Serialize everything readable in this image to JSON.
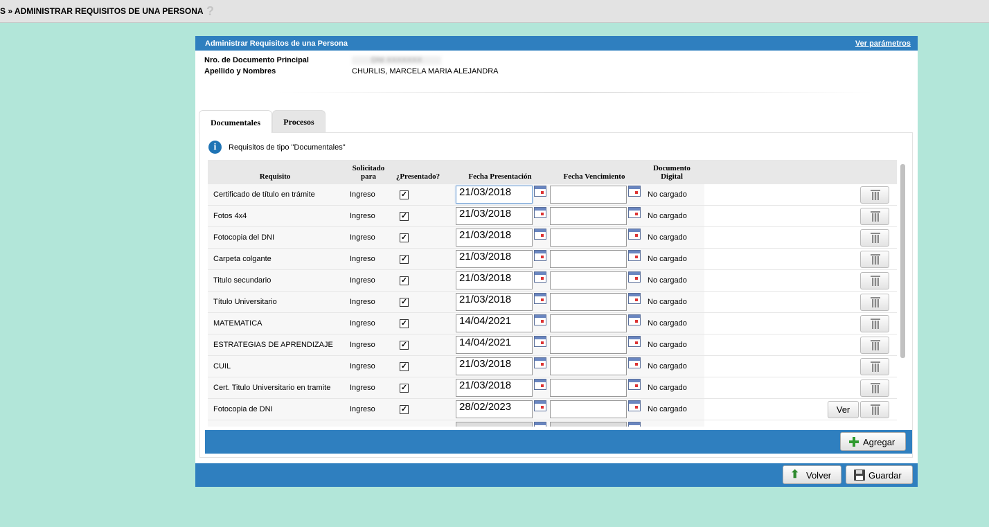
{
  "breadcrumb": {
    "prefix": "S »",
    "title": "ADMINISTRAR REQUISITOS DE UNA PERSONA",
    "help_icon": "question-icon"
  },
  "panel": {
    "title": "Administrar Requisitos de una Persona",
    "params_link": "Ver parámetros"
  },
  "person": {
    "doc_label": "Nro. de Documento Principal",
    "doc_value": "DNI XXXXXXX",
    "name_label": "Apellido y Nombres",
    "name_value": "CHURLIS, MARCELA MARIA ALEJANDRA"
  },
  "tabs": [
    {
      "label": "Documentales",
      "active": true
    },
    {
      "label": "Procesos",
      "active": false
    }
  ],
  "info": {
    "icon": "info-icon",
    "text": "Requisitos de tipo \"Documentales\""
  },
  "table": {
    "headers": {
      "requisito": "Requisito",
      "solicitado": "Solicitado para",
      "presentado": "¿Presentado?",
      "fecha_presentacion": "Fecha Presentación",
      "fecha_vencimiento": "Fecha Vencimiento",
      "documento_digital": "Documento Digital"
    },
    "rows": [
      {
        "requisito": "Certificado de título en trámite",
        "solicitado": "Ingreso",
        "presentado": "✓",
        "fecha": "21/03/2018",
        "vencimiento": "",
        "documento": "No cargado",
        "ver": ""
      },
      {
        "requisito": "Fotos 4x4",
        "solicitado": "Ingreso",
        "presentado": "✓",
        "fecha": "21/03/2018",
        "vencimiento": "",
        "documento": "No cargado",
        "ver": ""
      },
      {
        "requisito": "Fotocopia del DNI",
        "solicitado": "Ingreso",
        "presentado": "✓",
        "fecha": "21/03/2018",
        "vencimiento": "",
        "documento": "No cargado",
        "ver": ""
      },
      {
        "requisito": "Carpeta colgante",
        "solicitado": "Ingreso",
        "presentado": "✓",
        "fecha": "21/03/2018",
        "vencimiento": "",
        "documento": "No cargado",
        "ver": ""
      },
      {
        "requisito": "Titulo secundario",
        "solicitado": "Ingreso",
        "presentado": "✓",
        "fecha": "21/03/2018",
        "vencimiento": "",
        "documento": "No cargado",
        "ver": ""
      },
      {
        "requisito": "Título Universitario",
        "solicitado": "Ingreso",
        "presentado": "✓",
        "fecha": "21/03/2018",
        "vencimiento": "",
        "documento": "No cargado",
        "ver": ""
      },
      {
        "requisito": "MATEMATICA",
        "solicitado": "Ingreso",
        "presentado": "✓",
        "fecha": "14/04/2021",
        "vencimiento": "",
        "documento": "No cargado",
        "ver": ""
      },
      {
        "requisito": "ESTRATEGIAS DE APRENDIZAJE",
        "solicitado": "Ingreso",
        "presentado": "✓",
        "fecha": "14/04/2021",
        "vencimiento": "",
        "documento": "No cargado",
        "ver": ""
      },
      {
        "requisito": "CUIL",
        "solicitado": "Ingreso",
        "presentado": "✓",
        "fecha": "21/03/2018",
        "vencimiento": "",
        "documento": "No cargado",
        "ver": ""
      },
      {
        "requisito": "Cert. Titulo Universitario en tramite",
        "solicitado": "Ingreso",
        "presentado": "✓",
        "fecha": "21/03/2018",
        "vencimiento": "",
        "documento": "No cargado",
        "ver": ""
      },
      {
        "requisito": "Fotocopia de DNI",
        "solicitado": "Ingreso",
        "presentado": "✓",
        "fecha": "28/02/2023",
        "vencimiento": "",
        "documento": "No cargado",
        "ver": "Ver"
      },
      {
        "requisito": "",
        "solicitado": "",
        "presentado": "",
        "fecha": "",
        "vencimiento": "",
        "documento": "",
        "ver": ""
      }
    ]
  },
  "buttons": {
    "agregar": "Agregar",
    "volver": "Volver",
    "guardar": "Guardar"
  },
  "colors": {
    "background": "#b2e6d9",
    "bar": "#2f7fbf",
    "topbar": "#e3e3e3"
  }
}
